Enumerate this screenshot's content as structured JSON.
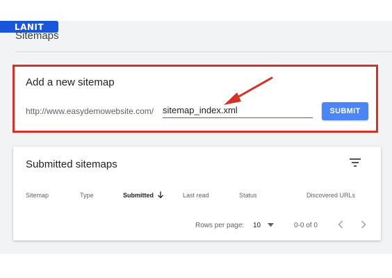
{
  "brand": {
    "logo_text": "LANIT",
    "color": "#1a56db"
  },
  "header": {
    "title": "Sitemaps"
  },
  "add_sitemap": {
    "title": "Add a new sitemap",
    "url_prefix": "http://www.easydemowebsite.com/",
    "input_value": "sitemap_index.xml",
    "submit_label": "SUBMIT",
    "highlight_color": "#d93025",
    "button_color": "#4a86f7"
  },
  "submitted": {
    "title": "Submitted sitemaps",
    "columns": [
      "Sitemap",
      "Type",
      "Submitted",
      "Last read",
      "Status",
      "Discovered URLs"
    ],
    "sorted_column": "Submitted",
    "sort_direction": "descending",
    "rows_per_page_label": "Rows per page:",
    "rows_per_page_value": "10",
    "range_text": "0-0 of 0"
  },
  "icons": [
    "filter-icon",
    "arrow-down-icon",
    "dropdown-icon",
    "chevron-left-icon",
    "chevron-right-icon",
    "arrow-annotation-icon"
  ]
}
